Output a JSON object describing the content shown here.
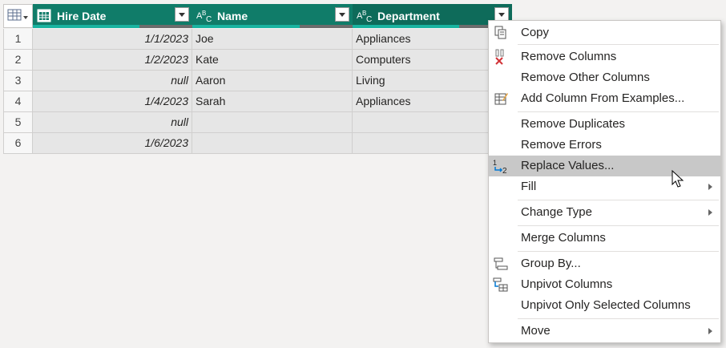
{
  "table": {
    "columns": [
      {
        "name": "Hire Date",
        "type_icon": "table-type-icon"
      },
      {
        "name": "Name",
        "type_icon": "text-type-icon"
      },
      {
        "name": "Department",
        "type_icon": "text-type-icon"
      }
    ],
    "rows": [
      {
        "index": "1",
        "hire_date": "1/1/2023",
        "name": "Joe",
        "department": "Appliances"
      },
      {
        "index": "2",
        "hire_date": "1/2/2023",
        "name": "Kate",
        "department": "Computers"
      },
      {
        "index": "3",
        "hire_date": "null",
        "name": "Aaron",
        "department": "Living"
      },
      {
        "index": "4",
        "hire_date": "1/4/2023",
        "name": "Sarah",
        "department": "Appliances"
      },
      {
        "index": "5",
        "hire_date": "null",
        "name": "",
        "department": ""
      },
      {
        "index": "6",
        "hire_date": "1/6/2023",
        "name": "",
        "department": ""
      }
    ]
  },
  "context_menu": {
    "items": [
      {
        "label": "Copy",
        "icon": "copy-icon"
      },
      {
        "label": "Remove Columns",
        "icon": "remove-columns-icon"
      },
      {
        "label": "Remove Other Columns"
      },
      {
        "label": "Add Column From Examples...",
        "icon": "add-column-examples-icon"
      },
      {
        "label": "Remove Duplicates"
      },
      {
        "label": "Remove Errors"
      },
      {
        "label": "Replace Values...",
        "icon": "replace-values-icon",
        "highlighted": true
      },
      {
        "label": "Fill",
        "submenu": true
      },
      {
        "label": "Change Type",
        "submenu": true
      },
      {
        "label": "Merge Columns"
      },
      {
        "label": "Group By...",
        "icon": "group-by-icon"
      },
      {
        "label": "Unpivot Columns",
        "icon": "unpivot-icon"
      },
      {
        "label": "Unpivot Only Selected Columns"
      },
      {
        "label": "Move",
        "submenu": true
      }
    ]
  },
  "colors": {
    "header": "#107c69",
    "quality_valid": "#19b4a0",
    "menu_highlight": "#c8c8c8"
  }
}
